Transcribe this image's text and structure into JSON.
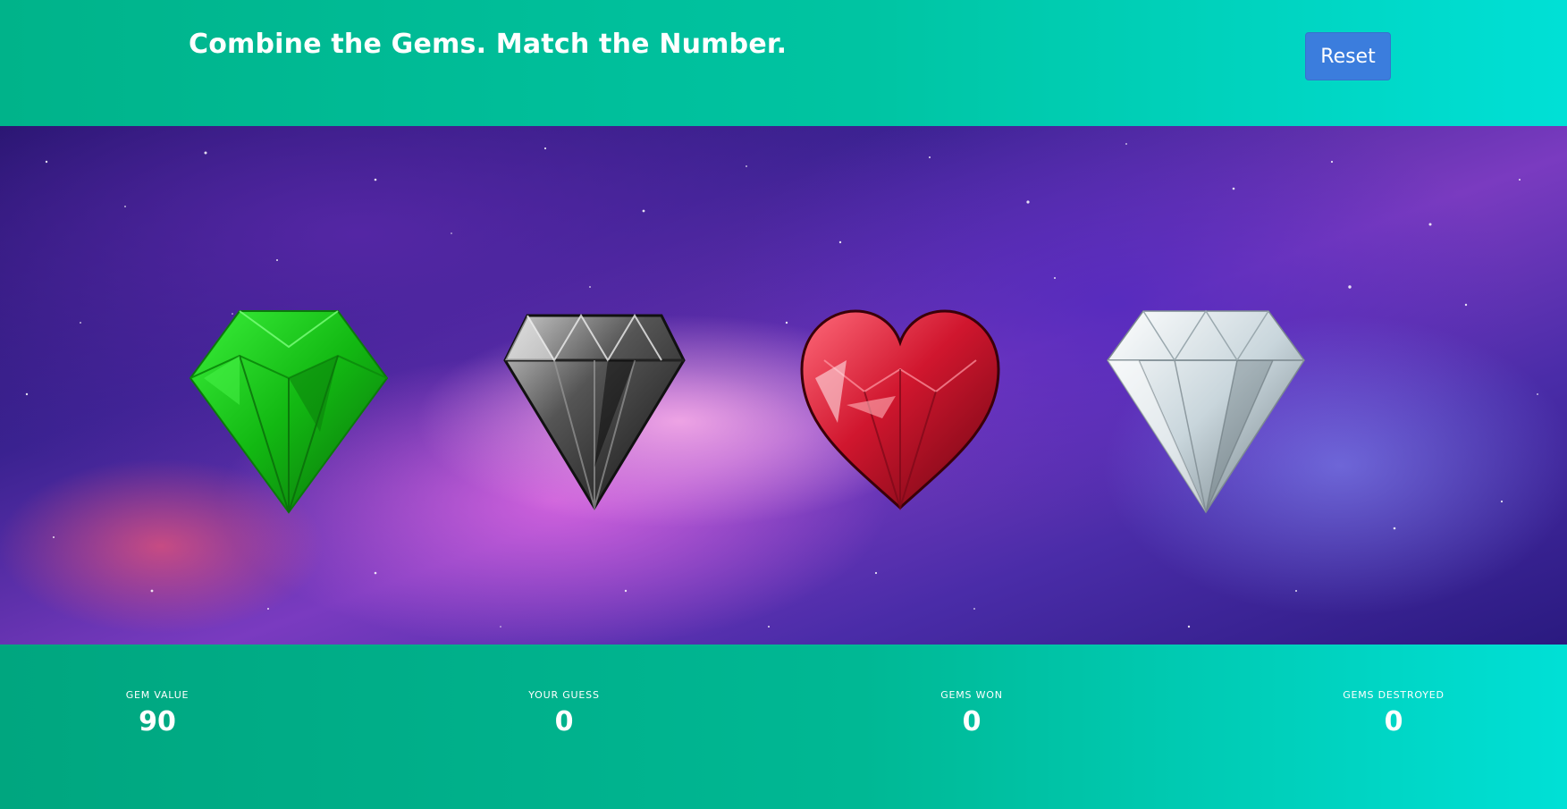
{
  "header": {
    "title": "Combine the Gems. Match the Number.",
    "reset_label": "Reset"
  },
  "gems": [
    {
      "name": "green-gem",
      "color": "#1fc41f"
    },
    {
      "name": "black-diamond",
      "color": "#3a3a3a"
    },
    {
      "name": "red-heart-gem",
      "color": "#c0142a"
    },
    {
      "name": "white-diamond",
      "color": "#e6eef2"
    }
  ],
  "stats": {
    "gem_value": {
      "label": "GEM VALUE",
      "value": "90"
    },
    "your_guess": {
      "label": "YOUR GUESS",
      "value": "0"
    },
    "gems_won": {
      "label": "GEMS WON",
      "value": "0"
    },
    "gems_destroyed": {
      "label": "GEMS DESTROYED",
      "value": "0"
    }
  },
  "colors": {
    "header_gradient": [
      "#00b38a",
      "#00e0d6"
    ],
    "button": "#3b7ddd",
    "text": "#ffffff"
  }
}
